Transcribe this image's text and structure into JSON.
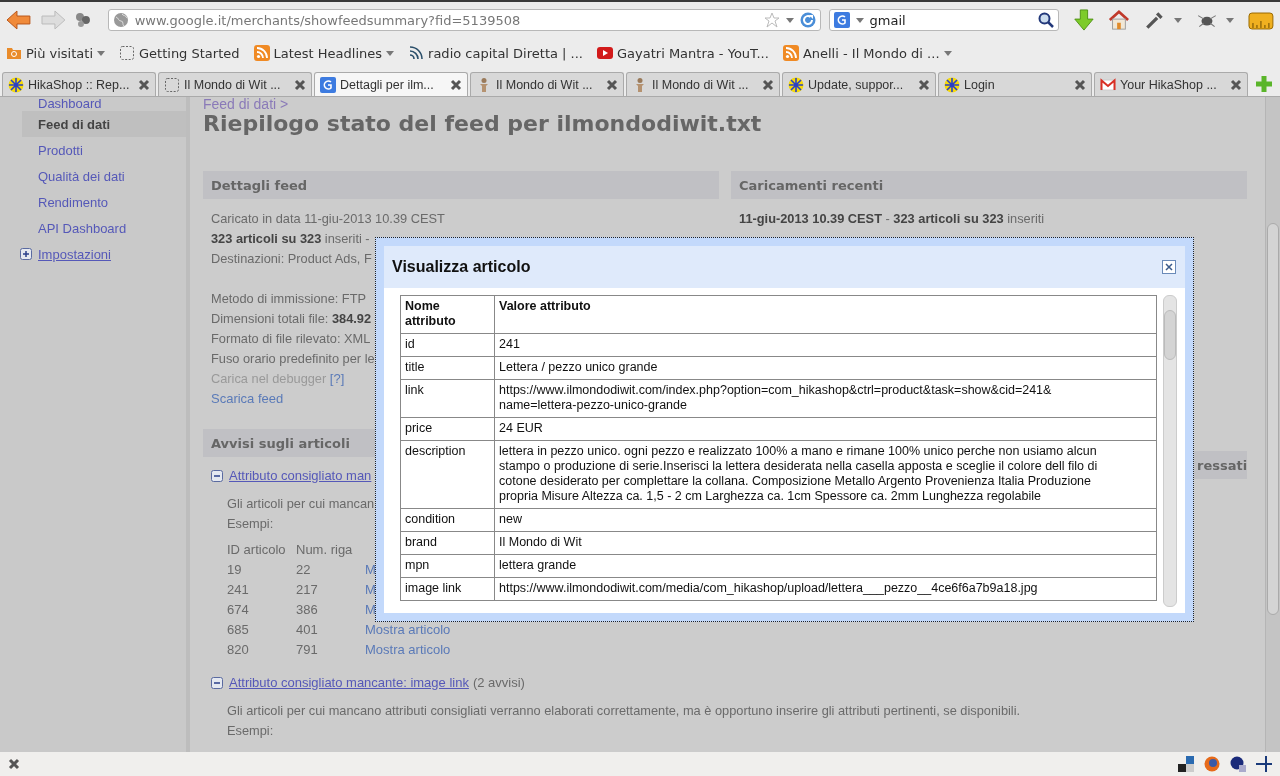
{
  "toolbar": {
    "url": "www.google.it/merchants/showfeedsummary?fid=5139508",
    "search": "gmail"
  },
  "bookmarks": [
    {
      "label": "Più visitati",
      "kind": "folder",
      "has_menu": true
    },
    {
      "label": "Getting Started",
      "kind": "blank",
      "has_menu": false
    },
    {
      "label": "Latest Headlines",
      "kind": "rss",
      "has_menu": true
    },
    {
      "label": "radio capital Diretta | ...",
      "kind": "waves",
      "has_menu": false
    },
    {
      "label": "Gayatri Mantra - YouT...",
      "kind": "play",
      "has_menu": false
    },
    {
      "label": "Anelli - Il Mondo di ...",
      "kind": "rss",
      "has_menu": true
    }
  ],
  "tabs": [
    {
      "label": "HikaShop :: Rep...",
      "kind": "flower",
      "selected": false
    },
    {
      "label": "Il Mondo di Wit ...",
      "kind": "blank",
      "selected": false
    },
    {
      "label": "Dettagli per ilm...",
      "kind": "google",
      "selected": true
    },
    {
      "label": "Il Mondo di Wit ...",
      "kind": "figure",
      "selected": false
    },
    {
      "label": "Il Mondo di Wit ...",
      "kind": "figure",
      "selected": false
    },
    {
      "label": "Update, suppor...",
      "kind": "flower",
      "selected": false
    },
    {
      "label": "Login",
      "kind": "flower",
      "selected": false
    },
    {
      "label": "Your HikaShop ...",
      "kind": "mail",
      "selected": false
    }
  ],
  "sidebar": {
    "items": [
      {
        "label": "Dashboard",
        "kind": "link",
        "selected": false
      },
      {
        "label": "Feed di dati",
        "kind": "link",
        "selected": true
      },
      {
        "label": "Prodotti",
        "kind": "link",
        "selected": false
      },
      {
        "label": "Qualità dei dati",
        "kind": "link",
        "selected": false
      },
      {
        "label": "Rendimento",
        "kind": "link",
        "selected": false
      },
      {
        "label": "API Dashboard",
        "kind": "link",
        "selected": false
      },
      {
        "label": "Impostazioni",
        "kind": "group",
        "selected": false,
        "expanded": false
      }
    ]
  },
  "breadcrumb": "Feed di dati >",
  "title": "Riepilogo stato del feed per ilmondodiwit.txt",
  "feed_details": {
    "heading": "Dettagli feed",
    "lines": [
      {
        "kind": "text",
        "text": "Caricato in data 11-giu-2013 10.39 CEST"
      },
      {
        "kind": "text",
        "text": "**323 articoli su 323** inseriti -"
      },
      {
        "kind": "text",
        "text": "Destinazioni: Product Ads, F"
      },
      {
        "kind": "gap"
      },
      {
        "kind": "text",
        "text": "Metodo di immissione: FTP"
      },
      {
        "kind": "text",
        "text": "Dimensioni totali file: **384.92**"
      },
      {
        "kind": "text",
        "text": "Formato di file rilevato: XML"
      },
      {
        "kind": "text",
        "text": "Fuso orario predefinito per le"
      },
      {
        "kind": "help",
        "text": "Carica nel debugger",
        "help": "[?]"
      },
      {
        "kind": "link",
        "text": "Scarica feed"
      }
    ]
  },
  "recent_uploads": {
    "heading": "Caricamenti recenti",
    "lines": [
      "**11-giu-2013 10.39 CEST** - **323 articoli su 323** inseriti"
    ]
  },
  "side_heading": "ressati",
  "warnings": {
    "heading": "Avvisi sugli articoli",
    "sections": [
      {
        "title": "Attributo consigliato man",
        "expanded": true,
        "description": "Gli articoli per cui mancan",
        "examples": "Esempi:",
        "columns": [
          "ID articolo",
          "Num. riga"
        ],
        "rows": [
          [
            "19",
            "22",
            "M"
          ],
          [
            "241",
            "217",
            "M"
          ],
          [
            "674",
            "386",
            "M"
          ],
          [
            "685",
            "401",
            "Mostra articolo"
          ],
          [
            "820",
            "791",
            "Mostra articolo"
          ]
        ]
      },
      {
        "title": "Attributo consigliato mancante: image link",
        "count": "(2 avvisi)",
        "expanded": true,
        "description": "Gli articoli per cui mancano attributi consigliati verranno elaborati correttamente, ma è opportuno inserire gli attributi pertinenti, se disponibili.",
        "examples": "Esempi:"
      }
    ]
  },
  "dialog": {
    "title": "Visualizza articolo",
    "columns": [
      "Nome attributo",
      "Valore attributo"
    ],
    "rows": [
      [
        "id",
        "241"
      ],
      [
        "title",
        "Lettera / pezzo unico grande"
      ],
      [
        "link",
        "https://www.ilmondodiwit.com/index.php?option=com_hikashop&ctrl=product&task=show&cid=241&\nname=lettera-pezzo-unico-grande"
      ],
      [
        "price",
        "24 EUR"
      ],
      [
        "description",
        "lettera in pezzo unico. ogni pezzo e realizzato 100% a mano e rimane 100% unico perche non usiamo alcun stampo o produzione di serie.Inserisci la lettera desiderata nella casella apposta e sceglie il colore dell filo di cotone desiderato per complettare la collana. Composizione Metallo Argento Provenienza Italia Produzione propria Misure Altezza ca. 1,5 - 2 cm Larghezza ca. 1cm Spessore ca. 2mm Lunghezza regolabile"
      ],
      [
        "condition",
        "new"
      ],
      [
        "brand",
        "Il Mondo di Wit"
      ],
      [
        "mpn",
        "lettera grande"
      ],
      [
        "image link",
        "https://www.ilmondodiwit.com/media/com_hikashop/upload/lettera___pezzo__4ce6f6a7b9a18.jpg"
      ]
    ]
  }
}
